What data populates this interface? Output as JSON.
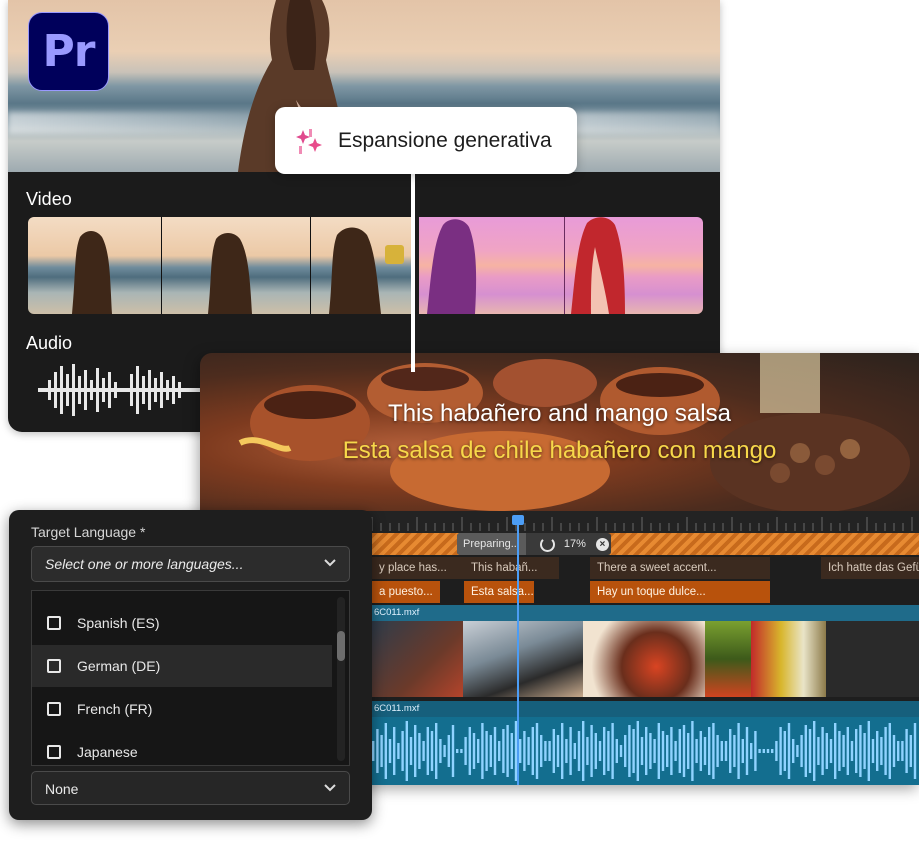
{
  "app": {
    "logo_text": "Pr",
    "accent": "#9999ff",
    "logo_bg": "#00005b"
  },
  "generative_extend": {
    "feature_label": "Espansione generativa",
    "video_label": "Video",
    "audio_label": "Audio"
  },
  "captions": {
    "english": "This habañero and mango salsa",
    "spanish": "Esta salsa de chile habañero con mango"
  },
  "timeline": {
    "progress_label": "Preparing...",
    "progress_percent": "17%",
    "progress_value": 0.17,
    "caption_track_1": [
      "y place has...",
      "This habañ...",
      "There a sweet accent...",
      "Ich hatte das Gefü"
    ],
    "caption_track_2": [
      "a puesto...",
      "Esta salsa...",
      "Hay un toque dulce..."
    ],
    "video_clip_name": "6C011.mxf",
    "audio_clip_name": "6C011.mxf"
  },
  "language_panel": {
    "title": "Target Language *",
    "select_placeholder": "Select one or more languages...",
    "options": [
      {
        "label": "Spanish (ES)",
        "checked": false
      },
      {
        "label": "German (DE)",
        "checked": false
      },
      {
        "label": "French (FR)",
        "checked": false
      },
      {
        "label": "Japanese",
        "checked": false
      }
    ],
    "second_select_value": "None"
  }
}
